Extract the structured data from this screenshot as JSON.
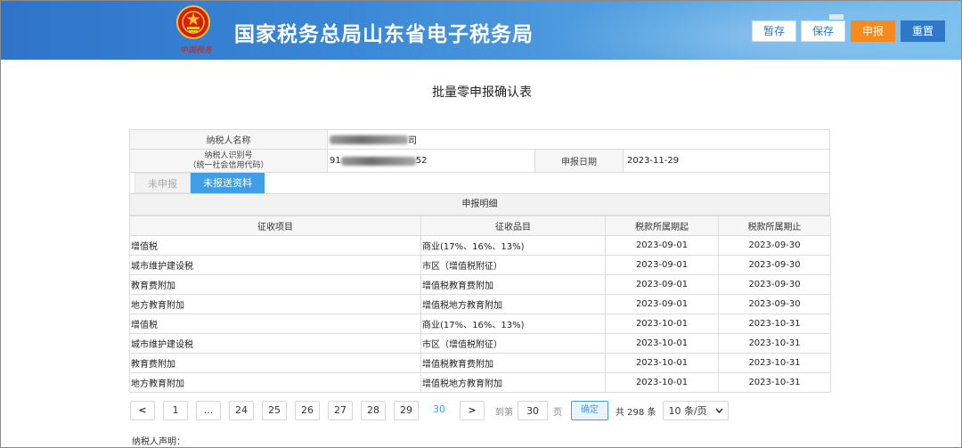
{
  "header": {
    "site_title": "国家税务总局山东省电子税务局",
    "emblem_caption": "中国税务",
    "buttons": {
      "save_temp": "暂存",
      "save": "保存",
      "declare": "申报",
      "reset": "重置"
    }
  },
  "page_title": "批量零申报确认表",
  "form": {
    "taxpayer_name_label": "纳税人名称",
    "taxpayer_name_visible_end": "司",
    "taxpayer_id_label_line1": "纳税人识别号",
    "taxpayer_id_label_line2": "（统一社会信用代码）",
    "taxpayer_id_visible_start": "91",
    "taxpayer_id_visible_end": "52",
    "declare_date_label": "申报日期",
    "declare_date": "2023-11-29"
  },
  "tabs": {
    "not_declared": "未申报",
    "not_submitted": "未报送资料"
  },
  "detail": {
    "section_title": "申报明细",
    "columns": [
      "征收项目",
      "征收品目",
      "税款所属期起",
      "税款所属期止"
    ],
    "rows": [
      [
        "增值税",
        "商业(17%、16%、13%)",
        "2023-09-01",
        "2023-09-30"
      ],
      [
        "城市维护建设税",
        "市区（增值税附征）",
        "2023-09-01",
        "2023-09-30"
      ],
      [
        "教育费附加",
        "增值税教育费附加",
        "2023-09-01",
        "2023-09-30"
      ],
      [
        "地方教育附加",
        "增值税地方教育附加",
        "2023-09-01",
        "2023-09-30"
      ],
      [
        "增值税",
        "商业(17%、16%、13%)",
        "2023-10-01",
        "2023-10-31"
      ],
      [
        "城市维护建设税",
        "市区（增值税附征）",
        "2023-10-01",
        "2023-10-31"
      ],
      [
        "教育费附加",
        "增值税教育费附加",
        "2023-10-01",
        "2023-10-31"
      ],
      [
        "地方教育附加",
        "增值税地方教育附加",
        "2023-10-01",
        "2023-10-31"
      ]
    ]
  },
  "pagination": {
    "prev": "<",
    "next": ">",
    "pages": [
      "1",
      "...",
      "24",
      "25",
      "26",
      "27",
      "28",
      "29"
    ],
    "current": "30",
    "goto_label": "到第",
    "goto_value": "30",
    "page_unit": "页",
    "confirm": "确定",
    "total": "共 298 条",
    "page_size": "10 条/页"
  },
  "declaration_label": "纳税人声明："
}
